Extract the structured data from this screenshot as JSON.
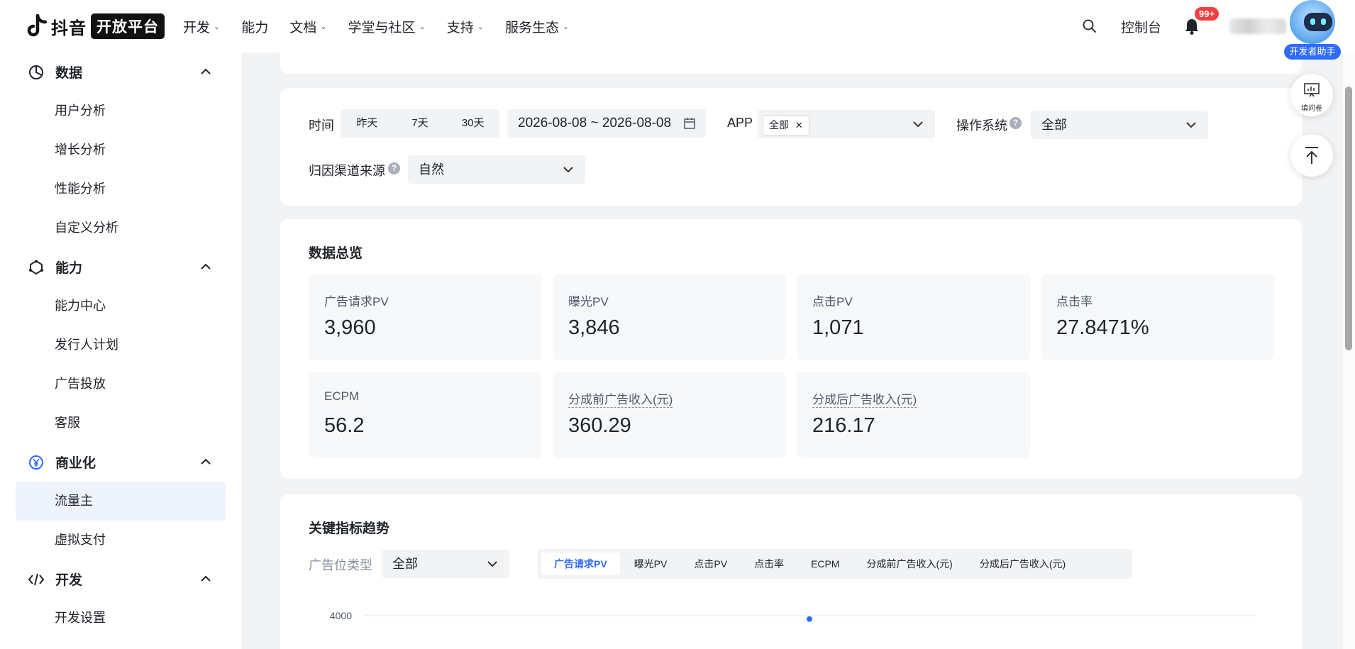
{
  "header": {
    "logo_text": "抖音",
    "logo_badge": "开放平台",
    "nav": [
      {
        "label": "开发",
        "has_dropdown": true
      },
      {
        "label": "能力",
        "has_dropdown": false
      },
      {
        "label": "文档",
        "has_dropdown": true
      },
      {
        "label": "学堂与社区",
        "has_dropdown": true
      },
      {
        "label": "支持",
        "has_dropdown": true
      },
      {
        "label": "服务生态",
        "has_dropdown": true
      }
    ],
    "console_label": "控制台",
    "notification_count": "99+",
    "assistant_label": "开发者助手"
  },
  "sidebar": {
    "sections": [
      {
        "label": "数据",
        "icon": "pie-chart-icon",
        "items": [
          "用户分析",
          "增长分析",
          "性能分析",
          "自定义分析"
        ]
      },
      {
        "label": "能力",
        "icon": "capability-icon",
        "items": [
          "能力中心",
          "发行人计划",
          "广告投放",
          "客服"
        ]
      },
      {
        "label": "商业化",
        "icon": "yen-icon",
        "items": [
          "流量主",
          "虚拟支付"
        ]
      },
      {
        "label": "开发",
        "icon": "code-icon",
        "items": [
          "开发设置"
        ]
      }
    ],
    "active_item": "流量主"
  },
  "filters": {
    "time_label": "时间",
    "time_options": [
      "昨天",
      "7天",
      "30天"
    ],
    "date_range": "2026-08-08 ~ 2026-08-08",
    "app_label": "APP",
    "app_tag": "全部",
    "os_label": "操作系统",
    "os_value": "全部",
    "channel_label": "归因渠道来源",
    "channel_value": "自然"
  },
  "overview": {
    "title": "数据总览",
    "metrics": [
      {
        "label": "广告请求PV",
        "value": "3,960"
      },
      {
        "label": "曝光PV",
        "value": "3,846"
      },
      {
        "label": "点击PV",
        "value": "1,071"
      },
      {
        "label": "点击率",
        "value": "27.8471%"
      },
      {
        "label": "ECPM",
        "value": "56.2"
      },
      {
        "label": "分成前广告收入(元)",
        "value": "360.29"
      },
      {
        "label": "分成后广告收入(元)",
        "value": "216.17"
      }
    ]
  },
  "trend": {
    "title": "关键指标趋势",
    "ad_type_label": "广告位类型",
    "ad_type_value": "全部",
    "tabs": [
      "广告请求PV",
      "曝光PV",
      "点击PV",
      "点击率",
      "ECPM",
      "分成前广告收入(元)",
      "分成后广告收入(元)"
    ],
    "active_tab": "广告请求PV"
  },
  "float_buttons": {
    "survey_label": "填问卷"
  },
  "chart_data": {
    "type": "line",
    "series": [
      {
        "values": [
          3960
        ]
      }
    ],
    "ytick_visible": "4000"
  },
  "colors": {
    "accent": "#2f6bff",
    "badge": "#f53f3f",
    "active_bg": "#eef3fe"
  }
}
